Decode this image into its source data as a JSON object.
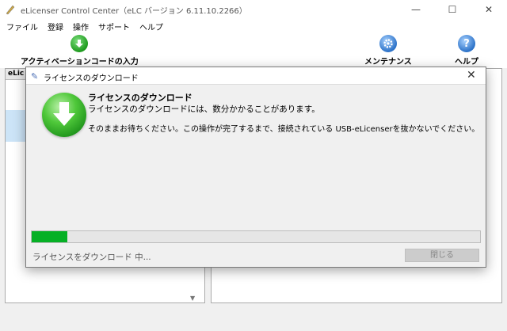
{
  "window": {
    "title": "eLicenser Control Center（eLC バージョン 6.11.10.2266）",
    "minimize_glyph": "—",
    "maximize_glyph": "☐",
    "close_glyph": "✕"
  },
  "menu": [
    {
      "label": "ファイル"
    },
    {
      "label": "登録"
    },
    {
      "label": "操作"
    },
    {
      "label": "サポート"
    },
    {
      "label": "ヘルプ"
    }
  ],
  "toolbar": {
    "activation_label": "アクティベーションコードの入力",
    "maintenance_label": "メンテナンス",
    "help_label": "ヘルプ",
    "help_glyph": "?"
  },
  "left_pane": {
    "header": "eLic"
  },
  "dialog": {
    "title": "ライセンスのダウンロード",
    "close_glyph": "✕",
    "heading": "ライセンスのダウンロード",
    "message1": "ライセンスのダウンロードには、数分かかることがあります。",
    "message2": "そのままお待ちください。この操作が完了するまで、接続されている USB-eLicenserを抜かないでください。",
    "progress_fraction": 0.08,
    "status": "ライセンスをダウンロード 中...",
    "close_button": "閉じる"
  },
  "colors": {
    "progress_green": "#06b025",
    "icon_green": "#4fc83a"
  }
}
